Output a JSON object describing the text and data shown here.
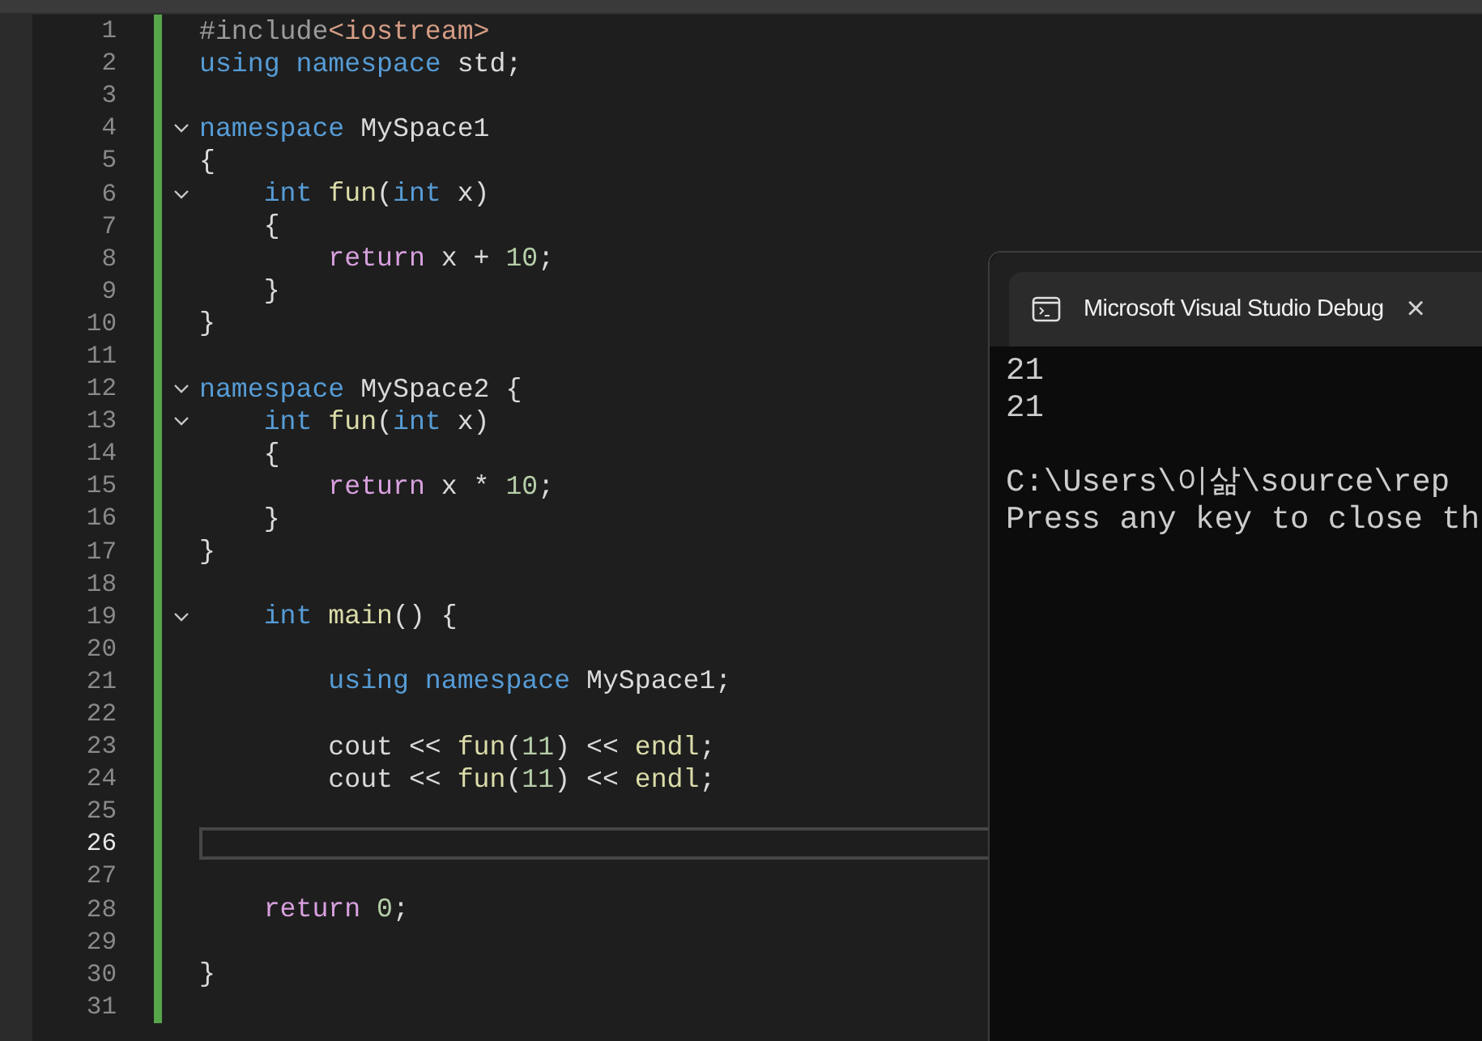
{
  "editor": {
    "lines": [
      {
        "number": "1",
        "fold": false,
        "current": false,
        "tokens": [
          {
            "kind": "preproc",
            "text": "#include"
          },
          {
            "kind": "string",
            "text": "<iostream>"
          }
        ]
      },
      {
        "number": "2",
        "fold": false,
        "current": false,
        "tokens": [
          {
            "kind": "keyword",
            "text": "using namespace"
          },
          {
            "kind": "plain",
            "text": " std;"
          }
        ]
      },
      {
        "number": "3",
        "fold": false,
        "current": false
      },
      {
        "number": "4",
        "fold": true,
        "current": false,
        "tokens": [
          {
            "kind": "keyword",
            "text": "namespace"
          },
          {
            "kind": "plain",
            "text": " MySpace1"
          }
        ]
      },
      {
        "number": "5",
        "fold": false,
        "current": false,
        "tokens": [
          {
            "kind": "plain",
            "text": "{"
          }
        ]
      },
      {
        "number": "6",
        "fold": true,
        "current": false,
        "tokens": [
          {
            "kind": "keyword",
            "text": "    int "
          },
          {
            "kind": "func",
            "text": "fun"
          },
          {
            "kind": "plain",
            "text": "("
          },
          {
            "kind": "keyword",
            "text": "int"
          },
          {
            "kind": "plain",
            "text": " x)"
          }
        ]
      },
      {
        "number": "7",
        "fold": false,
        "current": false,
        "tokens": [
          {
            "kind": "plain",
            "text": "    {"
          }
        ]
      },
      {
        "number": "8",
        "fold": false,
        "current": false,
        "tokens": [
          {
            "kind": "control",
            "text": "        return"
          },
          {
            "kind": "plain",
            "text": " x + "
          },
          {
            "kind": "number",
            "text": "10"
          },
          {
            "kind": "plain",
            "text": ";"
          }
        ]
      },
      {
        "number": "9",
        "fold": false,
        "current": false,
        "tokens": [
          {
            "kind": "plain",
            "text": "    }"
          }
        ]
      },
      {
        "number": "10",
        "fold": false,
        "current": false,
        "tokens": [
          {
            "kind": "plain",
            "text": "}"
          }
        ]
      },
      {
        "number": "11",
        "fold": false,
        "current": false
      },
      {
        "number": "12",
        "fold": true,
        "current": false,
        "tokens": [
          {
            "kind": "keyword",
            "text": "namespace"
          },
          {
            "kind": "plain",
            "text": " MySpace2 {"
          }
        ]
      },
      {
        "number": "13",
        "fold": true,
        "current": false,
        "tokens": [
          {
            "kind": "keyword",
            "text": "    int "
          },
          {
            "kind": "func",
            "text": "fun"
          },
          {
            "kind": "plain",
            "text": "("
          },
          {
            "kind": "keyword",
            "text": "int"
          },
          {
            "kind": "plain",
            "text": " x)"
          }
        ]
      },
      {
        "number": "14",
        "fold": false,
        "current": false,
        "tokens": [
          {
            "kind": "plain",
            "text": "    {"
          }
        ]
      },
      {
        "number": "15",
        "fold": false,
        "current": false,
        "tokens": [
          {
            "kind": "control",
            "text": "        return"
          },
          {
            "kind": "plain",
            "text": " x * "
          },
          {
            "kind": "number",
            "text": "10"
          },
          {
            "kind": "plain",
            "text": ";"
          }
        ]
      },
      {
        "number": "16",
        "fold": false,
        "current": false,
        "tokens": [
          {
            "kind": "plain",
            "text": "    }"
          }
        ]
      },
      {
        "number": "17",
        "fold": false,
        "current": false,
        "tokens": [
          {
            "kind": "plain",
            "text": "}"
          }
        ]
      },
      {
        "number": "18",
        "fold": false,
        "current": false
      },
      {
        "number": "19",
        "fold": true,
        "current": false,
        "tokens": [
          {
            "kind": "keyword",
            "text": "    int "
          },
          {
            "kind": "func",
            "text": "main"
          },
          {
            "kind": "plain",
            "text": "() {"
          }
        ]
      },
      {
        "number": "20",
        "fold": false,
        "current": false
      },
      {
        "number": "21",
        "fold": false,
        "current": false,
        "tokens": [
          {
            "kind": "keyword",
            "text": "        using namespace"
          },
          {
            "kind": "plain",
            "text": " MySpace1;"
          }
        ]
      },
      {
        "number": "22",
        "fold": false,
        "current": false
      },
      {
        "number": "23",
        "fold": false,
        "current": false,
        "tokens": [
          {
            "kind": "plain",
            "text": "        cout << "
          },
          {
            "kind": "func",
            "text": "fun"
          },
          {
            "kind": "plain",
            "text": "("
          },
          {
            "kind": "number",
            "text": "11"
          },
          {
            "kind": "plain",
            "text": ") << "
          },
          {
            "kind": "func",
            "text": "endl"
          },
          {
            "kind": "plain",
            "text": ";"
          }
        ]
      },
      {
        "number": "24",
        "fold": false,
        "current": false,
        "tokens": [
          {
            "kind": "plain",
            "text": "        cout << "
          },
          {
            "kind": "func",
            "text": "fun"
          },
          {
            "kind": "plain",
            "text": "("
          },
          {
            "kind": "number",
            "text": "11"
          },
          {
            "kind": "plain",
            "text": ") << "
          },
          {
            "kind": "func",
            "text": "endl"
          },
          {
            "kind": "plain",
            "text": ";"
          }
        ]
      },
      {
        "number": "25",
        "fold": false,
        "current": false
      },
      {
        "number": "26",
        "fold": false,
        "current": true
      },
      {
        "number": "27",
        "fold": false,
        "current": false
      },
      {
        "number": "28",
        "fold": false,
        "current": false,
        "tokens": [
          {
            "kind": "control",
            "text": "    return "
          },
          {
            "kind": "number",
            "text": "0"
          },
          {
            "kind": "plain",
            "text": ";"
          }
        ]
      },
      {
        "number": "29",
        "fold": false,
        "current": false
      },
      {
        "number": "30",
        "fold": false,
        "current": false,
        "tokens": [
          {
            "kind": "plain",
            "text": "}"
          }
        ]
      },
      {
        "number": "31",
        "fold": false,
        "current": false
      }
    ]
  },
  "console": {
    "title": "Microsoft Visual Studio Debug",
    "close": "×",
    "output_blocks": [
      {
        "lines": [
          "21",
          "21"
        ]
      },
      {
        "lines": [
          "C:\\Users\\이삶\\source\\rep",
          "Press any key to close th"
        ]
      }
    ]
  }
}
